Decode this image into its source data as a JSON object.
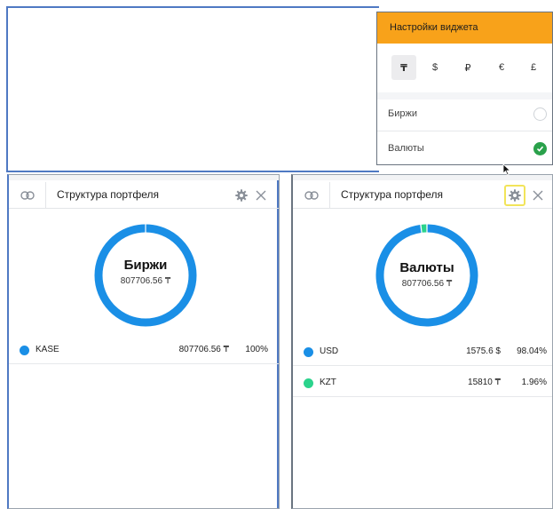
{
  "colors": {
    "accent_orange": "#f8a21a",
    "donut_blue": "#1a8fe6",
    "donut_green": "#2bd38c",
    "check_green": "#2aa14b",
    "frame_blue": "#4f79c3"
  },
  "settings_panel": {
    "title": "Настройки виджета",
    "currencies": [
      "₸",
      "$",
      "₽",
      "€",
      "£"
    ],
    "selected_currency": "₸",
    "options": [
      {
        "label": "Биржи",
        "checked": false
      },
      {
        "label": "Валюты",
        "checked": true
      }
    ]
  },
  "widgets": [
    {
      "title": "Структура портфеля",
      "link_icon": "link-icon",
      "settings_icon": "gear-icon",
      "close_icon": "close-icon",
      "gear_highlighted": false,
      "donut_title": "Биржи",
      "donut_total": "807706.56 ₸",
      "rows": [
        {
          "code": "KASE",
          "amount": "807706.56 ₸",
          "percent": "100%",
          "color": "#1a8fe6",
          "share": 1.0
        }
      ]
    },
    {
      "title": "Структура портфеля",
      "link_icon": "link-icon",
      "settings_icon": "gear-icon",
      "close_icon": "close-icon",
      "gear_highlighted": true,
      "donut_title": "Валюты",
      "donut_total": "807706.56 ₸",
      "rows": [
        {
          "code": "USD",
          "amount": "1575.6 $",
          "percent": "98.04%",
          "color": "#1a8fe6",
          "share": 0.9804
        },
        {
          "code": "KZT",
          "amount": "15810 ₸",
          "percent": "1.96%",
          "color": "#2bd38c",
          "share": 0.0196
        }
      ]
    }
  ]
}
